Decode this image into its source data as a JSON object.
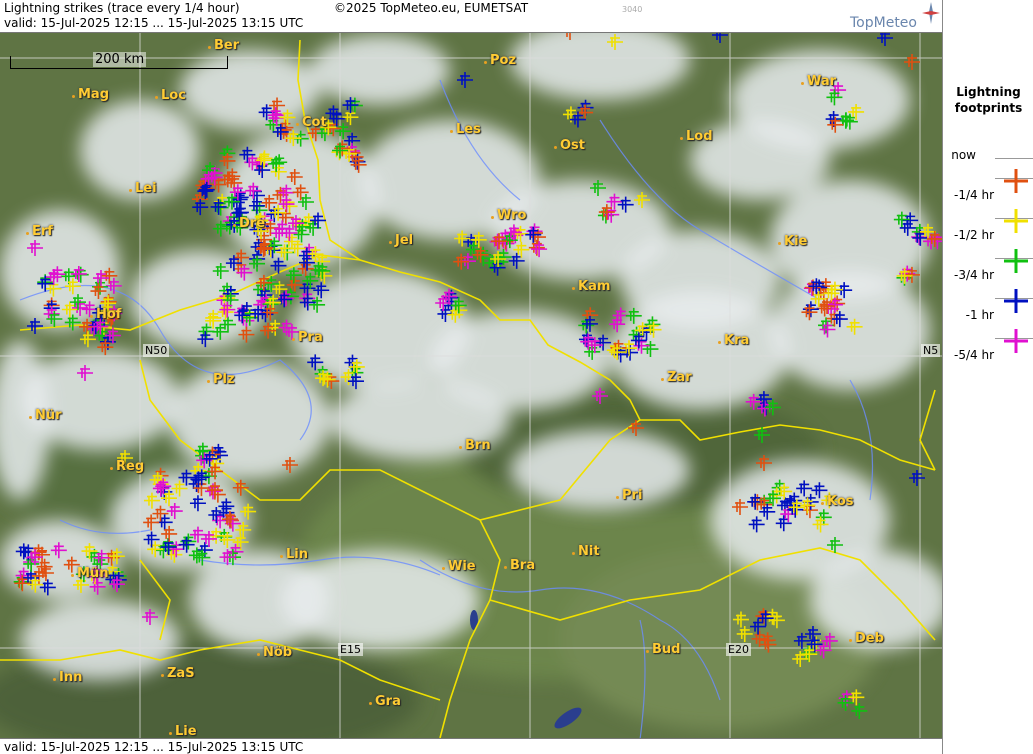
{
  "header": {
    "title": "Lightning strikes (trace every 1/4 hour)",
    "copyright": "©2025 TopMeteo.eu, EUMETSAT",
    "code": "3040",
    "valid": "valid:  15-Jul-2025 12:15 ... 15-Jul-2025 13:15 UTC"
  },
  "footer": {
    "valid": "valid:  15-Jul-2025 12:15 ... 15-Jul-2025 13:15 UTC"
  },
  "logo": {
    "text": "TopMeteo"
  },
  "scale": {
    "label": "200 km"
  },
  "grid_labels": {
    "n50_left": "N50",
    "n50_right": "N5",
    "e15": "E15",
    "e20": "E20"
  },
  "cities": [
    {
      "id": "ber",
      "label": "Ber"
    },
    {
      "id": "poz",
      "label": "Poz"
    },
    {
      "id": "mag",
      "label": "Mag"
    },
    {
      "id": "loc",
      "label": "Loc"
    },
    {
      "id": "war",
      "label": "War"
    },
    {
      "id": "cot",
      "label": "Cot"
    },
    {
      "id": "les",
      "label": "Les"
    },
    {
      "id": "lod",
      "label": "Lod"
    },
    {
      "id": "ost",
      "label": "Ost"
    },
    {
      "id": "lei",
      "label": "Lei"
    },
    {
      "id": "erf",
      "label": "Erf"
    },
    {
      "id": "dre",
      "label": "Dre"
    },
    {
      "id": "wro",
      "label": "Wro"
    },
    {
      "id": "jel",
      "label": "Jel"
    },
    {
      "id": "kie",
      "label": "Kie"
    },
    {
      "id": "kam",
      "label": "Kam"
    },
    {
      "id": "hof",
      "label": "Hof"
    },
    {
      "id": "pra",
      "label": "Pra"
    },
    {
      "id": "kra",
      "label": "Kra"
    },
    {
      "id": "zar",
      "label": "Zar"
    },
    {
      "id": "plz",
      "label": "Plz"
    },
    {
      "id": "nur",
      "label": "Nür"
    },
    {
      "id": "brn",
      "label": "Brn"
    },
    {
      "id": "reg",
      "label": "Reg"
    },
    {
      "id": "pri",
      "label": "Pri"
    },
    {
      "id": "kos",
      "label": "Kos"
    },
    {
      "id": "lin",
      "label": "Lin"
    },
    {
      "id": "nit",
      "label": "Nit"
    },
    {
      "id": "mun",
      "label": "Mün"
    },
    {
      "id": "wie",
      "label": "Wie"
    },
    {
      "id": "bra",
      "label": "Bra"
    },
    {
      "id": "deb",
      "label": "Deb"
    },
    {
      "id": "nob",
      "label": "Nöb"
    },
    {
      "id": "bud",
      "label": "Bud"
    },
    {
      "id": "inn",
      "label": "Inn"
    },
    {
      "id": "zas",
      "label": "ZaS"
    },
    {
      "id": "gra",
      "label": "Gra"
    },
    {
      "id": "lie",
      "label": "Lie"
    }
  ],
  "legend": {
    "title": "Lightning footprints",
    "items": [
      {
        "label": "now",
        "color": ""
      },
      {
        "label": "-1/4 hr",
        "color": "#e05010"
      },
      {
        "label": "-1/2 hr",
        "color": "#f0e000"
      },
      {
        "label": "-3/4 hr",
        "color": "#10c010"
      },
      {
        "label": "-1 hr",
        "color": "#0010c0"
      },
      {
        "label": "-5/4 hr",
        "color": "#e010d0"
      }
    ]
  },
  "colors": {
    "border": "#f0e000",
    "land": "#5f7444",
    "cloud": "#e8ecee",
    "river": "#6c8cff"
  },
  "strike_counts_visible_order": [
    "-1/4 hr",
    "-1/2 hr",
    "-3/4 hr",
    "-1 hr",
    "-5/4 hr"
  ]
}
